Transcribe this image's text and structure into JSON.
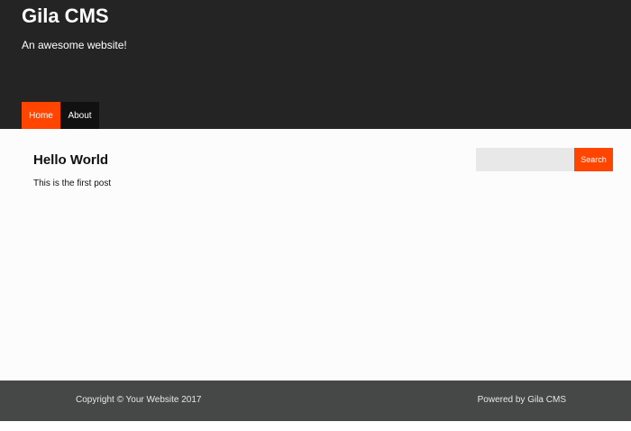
{
  "header": {
    "site_title": "Gila CMS",
    "tagline": "An awesome website!",
    "nav": [
      {
        "label": "Home",
        "active": true
      },
      {
        "label": "About",
        "active": false
      }
    ]
  },
  "main": {
    "post_title": "Hello World",
    "post_body": "This is the first post",
    "search": {
      "value": "",
      "placeholder": "",
      "button_label": "Search"
    }
  },
  "footer": {
    "copyright": "Copyright © Your Website 2017",
    "powered_by": "Powered by Gila CMS"
  },
  "colors": {
    "header_bg": "#242424",
    "accent": "#ff4500",
    "footer_bg": "#454846",
    "content_bg": "#fcfcfc"
  }
}
